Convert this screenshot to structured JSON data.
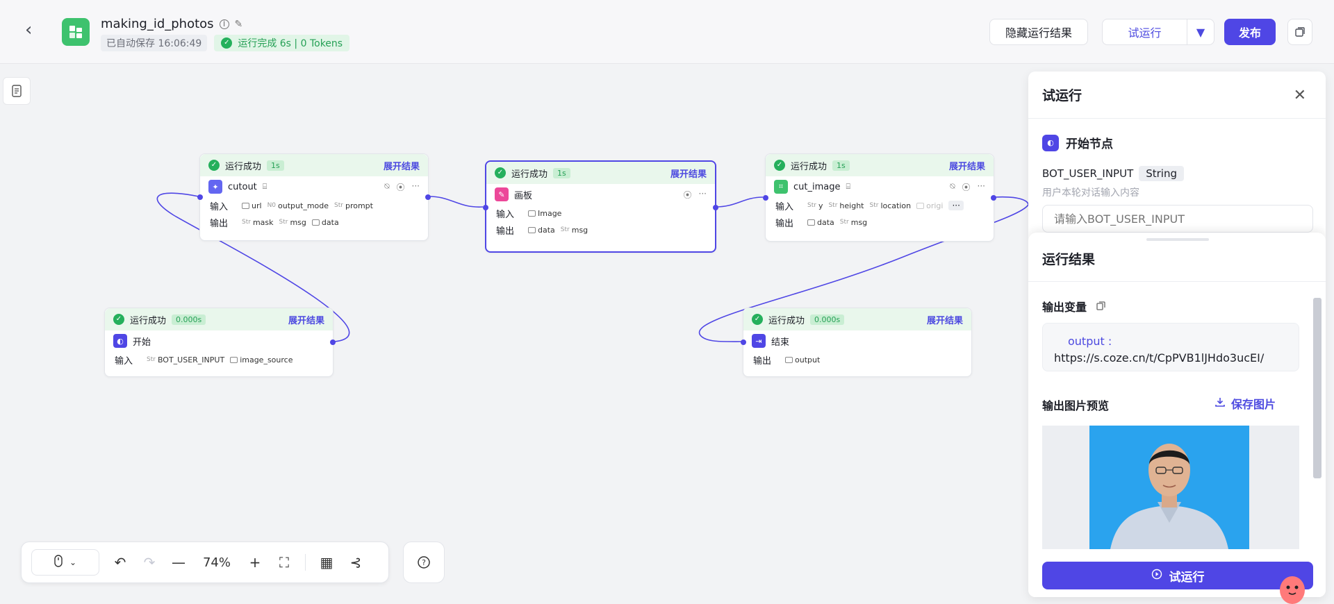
{
  "header": {
    "title": "making_id_photos",
    "autosave": "已自动保存 16:06:49",
    "run_status": "运行完成 6s | 0 Tokens",
    "hide_results": "隐藏运行结果",
    "try_run": "试运行",
    "publish": "发布"
  },
  "nodes": {
    "cutout": {
      "status": "运行成功",
      "duration": "1s",
      "expand": "展开结果",
      "title": "cutout",
      "input_label": "输入",
      "output_label": "输出",
      "inputs": [
        {
          "t": "img",
          "n": "url"
        },
        {
          "t": "N0",
          "n": "output_mode"
        },
        {
          "t": "Str",
          "n": "prompt"
        }
      ],
      "outputs": [
        {
          "t": "Str",
          "n": "mask"
        },
        {
          "t": "Str",
          "n": "msg"
        },
        {
          "t": "img",
          "n": "data"
        }
      ]
    },
    "canvas": {
      "status": "运行成功",
      "duration": "1s",
      "expand": "展开结果",
      "title": "画板",
      "input_label": "输入",
      "output_label": "输出",
      "inputs": [
        {
          "t": "img",
          "n": "Image"
        }
      ],
      "outputs": [
        {
          "t": "img",
          "n": "data"
        },
        {
          "t": "Str",
          "n": "msg"
        }
      ]
    },
    "cut_image": {
      "status": "运行成功",
      "duration": "1s",
      "expand": "展开结果",
      "title": "cut_image",
      "input_label": "输入",
      "output_label": "输出",
      "inputs": [
        {
          "t": "Str",
          "n": "y"
        },
        {
          "t": "Str",
          "n": "height"
        },
        {
          "t": "Str",
          "n": "location"
        },
        {
          "t": "img",
          "n": "origi"
        }
      ],
      "outputs": [
        {
          "t": "img",
          "n": "data"
        },
        {
          "t": "Str",
          "n": "msg"
        }
      ]
    },
    "start": {
      "status": "运行成功",
      "duration": "0.000s",
      "expand": "展开结果",
      "title": "开始",
      "input_label": "输入",
      "inputs": [
        {
          "t": "Str",
          "n": "BOT_USER_INPUT"
        },
        {
          "t": "img",
          "n": "image_source"
        }
      ]
    },
    "end": {
      "status": "运行成功",
      "duration": "0.000s",
      "expand": "展开结果",
      "title": "结束",
      "output_label": "输出",
      "outputs": [
        {
          "t": "img",
          "n": "output"
        }
      ]
    }
  },
  "toolbar": {
    "zoom": "74%"
  },
  "panel": {
    "title": "试运行",
    "start_node": "开始节点",
    "var_name": "BOT_USER_INPUT",
    "var_type": "String",
    "var_desc": "用户本轮对话输入内容",
    "var_placeholder": "请输入BOT_USER_INPUT",
    "result_title": "运行结果",
    "output_var": "输出变量",
    "output_key": "output :",
    "output_value": "https://s.coze.cn/t/CpPVB1lJHdo3ucEI/",
    "preview_title": "输出图片预览",
    "save_image": "保存图片",
    "try_run_button": "试运行"
  },
  "colors": {
    "accent": "#4f46e5",
    "success": "#25b05c",
    "canvas": "#f2f3f5"
  }
}
